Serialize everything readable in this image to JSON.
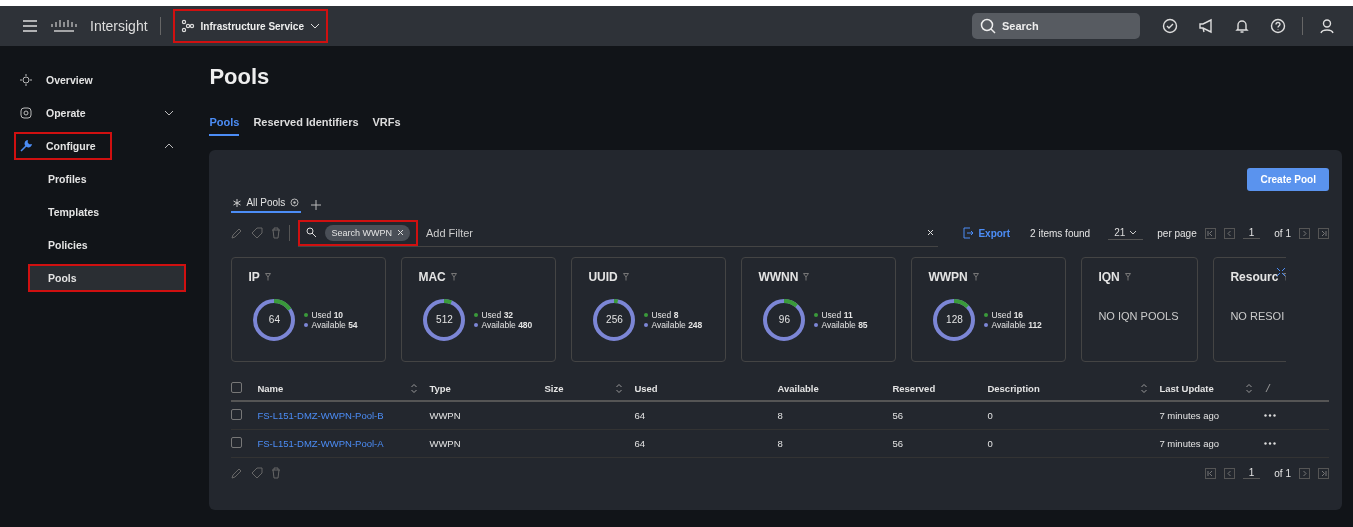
{
  "topbar": {
    "brand": "Intersight",
    "service": {
      "label": "Infrastructure Service",
      "highlighted": true
    },
    "search": {
      "placeholder": "Search"
    }
  },
  "sidebar": {
    "items": [
      {
        "label": "Overview",
        "selected": false,
        "highlighted": false
      },
      {
        "label": "Operate",
        "expanded": false,
        "selected": false,
        "highlighted": false
      },
      {
        "label": "Configure",
        "expanded": true,
        "selected": false,
        "highlighted": true,
        "children": [
          {
            "label": "Profiles",
            "selected": false,
            "highlighted": false
          },
          {
            "label": "Templates",
            "selected": false,
            "highlighted": false
          },
          {
            "label": "Policies",
            "selected": false,
            "highlighted": false
          },
          {
            "label": "Pools",
            "selected": true,
            "highlighted": true
          }
        ]
      }
    ]
  },
  "page": {
    "title": "Pools",
    "tabs": [
      {
        "label": "Pools",
        "selected": true
      },
      {
        "label": "Reserved Identifiers",
        "selected": false
      },
      {
        "label": "VRFs",
        "selected": false
      }
    ]
  },
  "panel": {
    "create_button": "Create Pool",
    "view_tabs": [
      {
        "label": "All Pools",
        "selected": true
      }
    ],
    "filter": {
      "chip": "Search WWPN",
      "chip_highlighted": true,
      "placeholder": "Add Filter"
    },
    "export": "Export",
    "items_found": "2 items found",
    "per_page": "21",
    "per_page_label": "per page",
    "page": "1",
    "page_of": "of 1",
    "cards": [
      {
        "kind": "donut",
        "title": "IP",
        "total": "64",
        "used_label": "Used",
        "used": "10",
        "available_label": "Available",
        "available": "54"
      },
      {
        "kind": "donut",
        "title": "MAC",
        "total": "512",
        "used_label": "Used",
        "used": "32",
        "available_label": "Available",
        "available": "480"
      },
      {
        "kind": "donut",
        "title": "UUID",
        "total": "256",
        "used_label": "Used",
        "used": "8",
        "available_label": "Available",
        "available": "248"
      },
      {
        "kind": "donut",
        "title": "WWNN",
        "total": "96",
        "used_label": "Used",
        "used": "11",
        "available_label": "Available",
        "available": "85"
      },
      {
        "kind": "donut",
        "title": "WWPN",
        "total": "128",
        "used_label": "Used",
        "used": "16",
        "available_label": "Available",
        "available": "112"
      },
      {
        "kind": "empty",
        "title": "IQN",
        "message": "NO IQN POOLS"
      },
      {
        "kind": "empty",
        "title": "Resourc",
        "message": "NO RESOI"
      }
    ],
    "table": {
      "select_all_checked": false,
      "columns": [
        {
          "label": "Name",
          "sortable": true
        },
        {
          "label": "Type",
          "sortable": false
        },
        {
          "label": "Size",
          "sortable": true
        },
        {
          "label": "Used",
          "sortable": false
        },
        {
          "label": "Available",
          "sortable": false
        },
        {
          "label": "Reserved",
          "sortable": false
        },
        {
          "label": "Description",
          "sortable": true
        },
        {
          "label": "Last Update",
          "sortable": true
        }
      ],
      "rows": [
        {
          "checked": false,
          "cells": [
            "FS-L151-DMZ-WWPN-Pool-B",
            "WWPN",
            "",
            "64",
            "8",
            "56",
            "0",
            "7 minutes ago"
          ]
        },
        {
          "checked": false,
          "cells": [
            "FS-L151-DMZ-WWPN-Pool-A",
            "WWPN",
            "",
            "64",
            "8",
            "56",
            "0",
            "7 minutes ago"
          ]
        }
      ]
    },
    "footer": {
      "page": "1",
      "page_of": "of 1"
    }
  }
}
